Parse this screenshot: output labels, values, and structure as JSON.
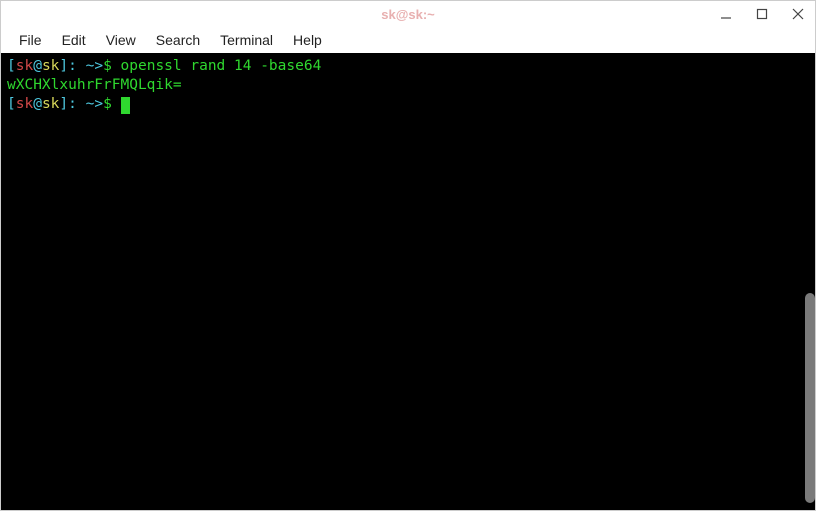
{
  "titlebar": {
    "title": "sk@sk:~"
  },
  "menubar": {
    "items": [
      "File",
      "Edit",
      "View",
      "Search",
      "Terminal",
      "Help"
    ]
  },
  "terminal": {
    "lines": [
      {
        "prompt": {
          "bracket_open": "[",
          "user": "sk",
          "at": "@",
          "host": "sk",
          "bracket_close": "]",
          "path": ": ~>",
          "dollar": "$ "
        },
        "command": "openssl rand 14 -base64"
      },
      {
        "output": "wXCHXlxuhrFrFMQLqik="
      },
      {
        "prompt": {
          "bracket_open": "[",
          "user": "sk",
          "at": "@",
          "host": "sk",
          "bracket_close": "]",
          "path": ": ~>",
          "dollar": "$ "
        }
      }
    ]
  }
}
